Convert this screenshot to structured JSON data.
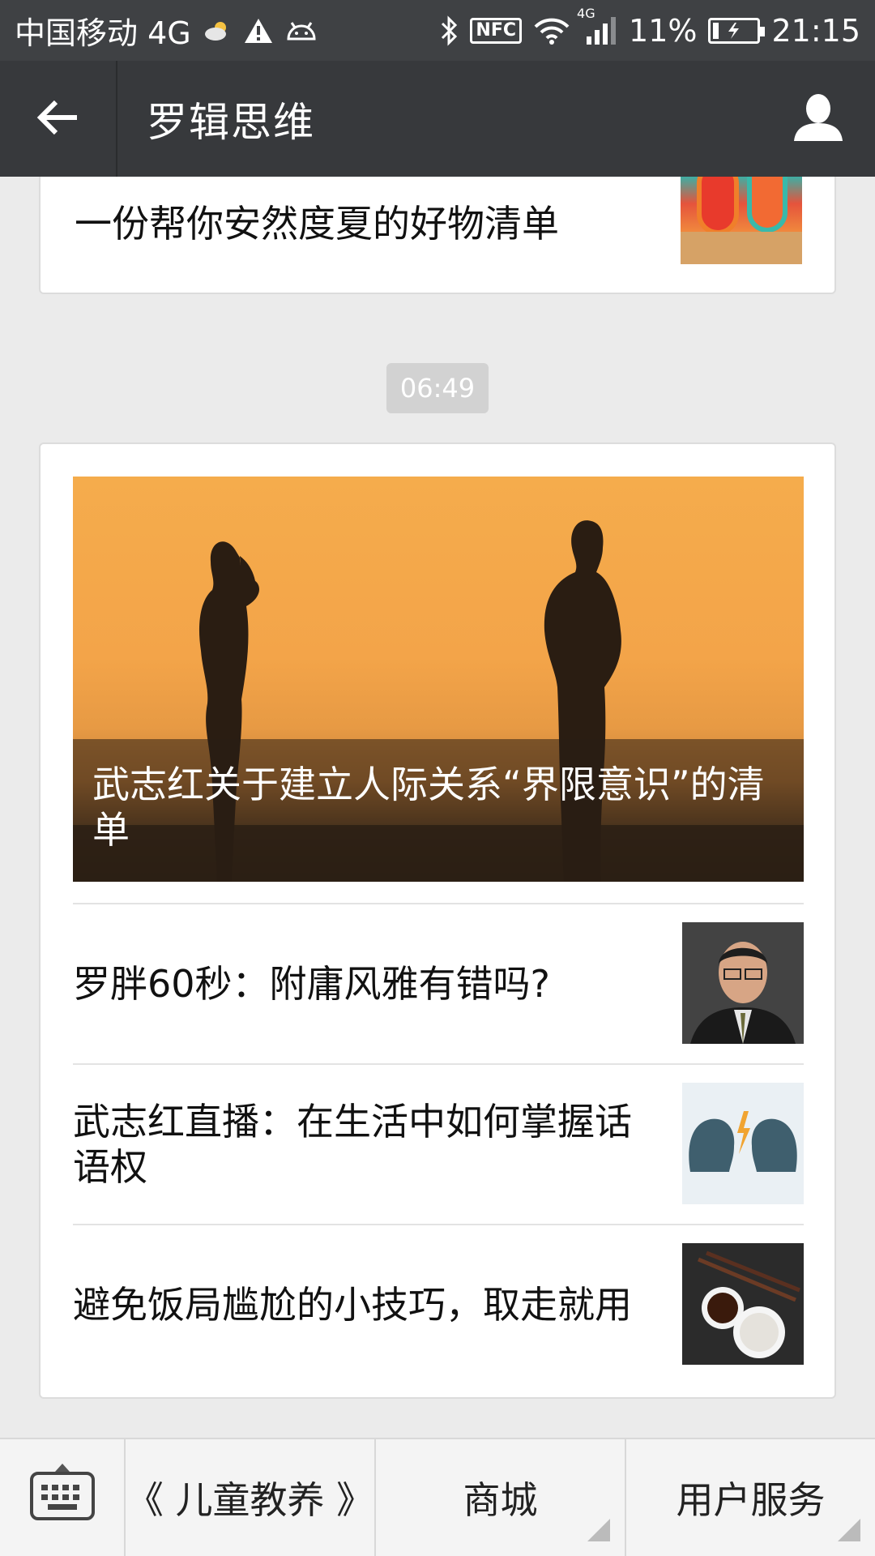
{
  "status_bar": {
    "carrier": "中国移动 4G",
    "network_small": "4G",
    "battery_percent": "11%",
    "battery_level": 0.11,
    "time": "21:15",
    "nfc": "NFC"
  },
  "header": {
    "title": "罗辑思维"
  },
  "feed": {
    "previous_article_title": "一份帮你安然度夏的好物清单",
    "timestamp": "06:49",
    "featured": {
      "title": "武志红关于建立人际关系“界限意识”的清单"
    },
    "articles": [
      {
        "title": "罗胖60秒：附庸风雅有错吗?"
      },
      {
        "title": "武志红直播：在生活中如何掌握话语权"
      },
      {
        "title": "避免饭局尴尬的小技巧，取走就用"
      }
    ]
  },
  "bottom_menu": {
    "items": [
      {
        "label": "《 儿童教养 》"
      },
      {
        "label": "商城"
      },
      {
        "label": "用户服务"
      }
    ]
  },
  "colors": {
    "status_bar_bg": "#3f4144",
    "title_bar_bg": "#37393c",
    "page_bg": "#ebebeb",
    "hero_orange": "#f5ac4c"
  }
}
